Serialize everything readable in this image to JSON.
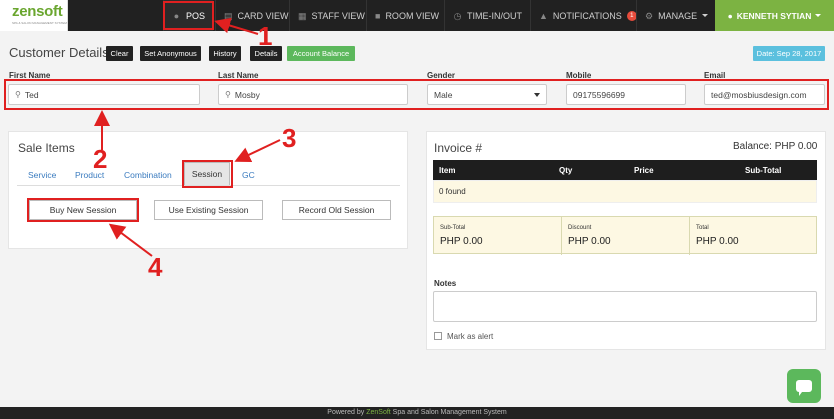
{
  "nav": {
    "brand": "zensoft",
    "brand_tag": "SPA & SALON MANAGEMENT SYSTEM",
    "items": [
      {
        "label": "POS",
        "icon": "users-icon"
      },
      {
        "label": "CARD VIEW",
        "icon": "card-icon"
      },
      {
        "label": "STAFF VIEW",
        "icon": "staff-icon"
      },
      {
        "label": "ROOM VIEW",
        "icon": "room-icon"
      },
      {
        "label": "TIME-IN/OUT",
        "icon": "clock-icon"
      },
      {
        "label": "NOTIFICATIONS",
        "icon": "bell-icon",
        "badge": "1"
      },
      {
        "label": "MANAGE",
        "icon": "gear-icon"
      }
    ],
    "user": "KENNETH SYTIAN"
  },
  "customer": {
    "title": "Customer Details",
    "buttons": {
      "clear": "Clear",
      "anonymous": "Set Anonymous",
      "history": "History",
      "details": "Details",
      "balance": "Account Balance"
    },
    "date": "Date: Sep 28, 2017",
    "fields": {
      "first_name": {
        "label": "First Name",
        "value": "Ted"
      },
      "last_name": {
        "label": "Last Name",
        "value": "Mosby"
      },
      "gender": {
        "label": "Gender",
        "value": "Male"
      },
      "mobile": {
        "label": "Mobile",
        "value": "09175596699"
      },
      "email": {
        "label": "Email",
        "value": "ted@mosbiusdesign.com"
      }
    }
  },
  "sale": {
    "title": "Sale Items",
    "tabs": [
      "Service",
      "Product",
      "Combination",
      "Session",
      "GC"
    ],
    "active_tab": "Session",
    "buttons": {
      "buy": "Buy New Session",
      "use": "Use Existing Session",
      "record": "Record Old Session"
    }
  },
  "invoice": {
    "title": "Invoice #",
    "balance": "Balance: PHP 0.00",
    "columns": [
      "Item",
      "Qty",
      "Price",
      "Sub-Total"
    ],
    "empty": "0 found",
    "totals": [
      {
        "label": "Sub-Total",
        "value": "PHP 0.00"
      },
      {
        "label": "Discount",
        "value": "PHP 0.00"
      },
      {
        "label": "Total",
        "value": "PHP 0.00"
      }
    ],
    "notes_label": "Notes",
    "alert_label": "Mark as alert"
  },
  "footer": {
    "prefix": "Powered by ",
    "brand": "ZenSoft",
    "suffix": " Spa and Salon Management System"
  },
  "annotations": {
    "n1": "1",
    "n2": "2",
    "n3": "3",
    "n4": "4",
    "color": "#e02020"
  },
  "colors": {
    "brand_green": "#7cb342",
    "info": "#5bc0de",
    "success": "#5cb85c",
    "nav_bg": "#212121"
  }
}
